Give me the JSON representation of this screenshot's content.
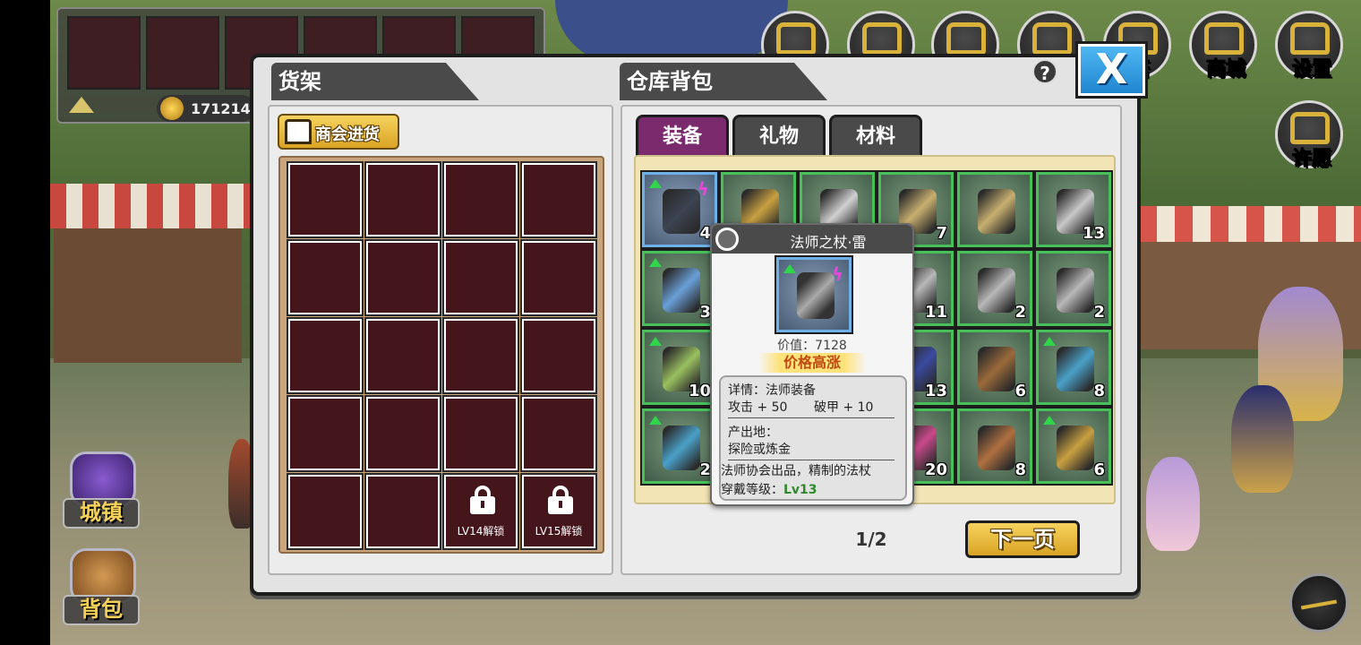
{
  "hud": {
    "coins": "171214"
  },
  "top_icons": [
    {
      "icon": "gift-icon",
      "label": ""
    },
    {
      "icon": "trophy-icon",
      "label": ""
    },
    {
      "icon": "badge-icon",
      "label": ""
    },
    {
      "icon": "glove-icon",
      "label": ""
    },
    {
      "icon": "helmet-icon",
      "label": "塔"
    },
    {
      "icon": "shop-icon",
      "label": "商城"
    },
    {
      "icon": "gear-icon",
      "label": "设置"
    },
    {
      "icon": "wish-icon",
      "label": "许愿"
    }
  ],
  "side_buttons": {
    "town": "城镇",
    "bag": "背包"
  },
  "shelf": {
    "title": "货架",
    "restock_label": "商会进货",
    "locked_slots": [
      "LV14解锁",
      "LV15解锁"
    ]
  },
  "warehouse": {
    "title": "仓库背包",
    "tabs": [
      "装备",
      "礼物",
      "材料"
    ],
    "active_tab": "装备",
    "items": [
      {
        "count": "4",
        "up": true,
        "bolt": true,
        "color": "#3c4452"
      },
      {
        "count": "",
        "up": false,
        "bolt": false,
        "color": "#c8a040"
      },
      {
        "count": "",
        "up": false,
        "bolt": false,
        "color": "#d0d0d0"
      },
      {
        "count": "7",
        "up": false,
        "bolt": false,
        "color": "#c8b070"
      },
      {
        "count": "",
        "up": false,
        "bolt": false,
        "color": "#c8b070"
      },
      {
        "count": "13",
        "up": false,
        "bolt": false,
        "color": "#c8c8c8"
      },
      {
        "count": "3",
        "up": true,
        "bolt": false,
        "color": "#6aa0d8"
      },
      {
        "count": "",
        "up": false,
        "bolt": false,
        "color": "#8a8a8a"
      },
      {
        "count": "",
        "up": false,
        "bolt": false,
        "color": "#8a8a8a"
      },
      {
        "count": "11",
        "up": false,
        "bolt": false,
        "color": "#b8b8b8"
      },
      {
        "count": "2",
        "up": false,
        "bolt": false,
        "color": "#b8b8b8"
      },
      {
        "count": "2",
        "up": false,
        "bolt": false,
        "color": "#b8b8b8"
      },
      {
        "count": "10",
        "up": true,
        "bolt": false,
        "color": "#9ac060"
      },
      {
        "count": "",
        "up": false,
        "bolt": false,
        "color": "#8a8a8a"
      },
      {
        "count": "",
        "up": false,
        "bolt": false,
        "color": "#8a8a8a"
      },
      {
        "count": "13",
        "up": false,
        "bolt": false,
        "color": "#3a4aa0"
      },
      {
        "count": "6",
        "up": false,
        "bolt": false,
        "color": "#9a6a3a"
      },
      {
        "count": "8",
        "up": true,
        "bolt": false,
        "color": "#4aa0c8"
      },
      {
        "count": "2",
        "up": true,
        "bolt": false,
        "color": "#4aa0c8"
      },
      {
        "count": "",
        "up": false,
        "bolt": false,
        "color": "#8a8a8a"
      },
      {
        "count": "",
        "up": false,
        "bolt": false,
        "color": "#8a8a8a"
      },
      {
        "count": "20",
        "up": false,
        "bolt": false,
        "color": "#c84a8a"
      },
      {
        "count": "8",
        "up": false,
        "bolt": false,
        "color": "#b07040"
      },
      {
        "count": "6",
        "up": true,
        "bolt": false,
        "color": "#c8a040"
      }
    ],
    "page": "1/2",
    "next_label": "下一页"
  },
  "tooltip": {
    "name": "法师之杖·雷",
    "value": "价值：7128",
    "price_tag": "价格高涨",
    "detail": "详情：法师装备",
    "attack": "攻击 + 50",
    "armor_break": "破甲 + 10",
    "origin_label": "产出地：",
    "origin": "探险或炼金",
    "desc": "法师协会出品，精制的法杖",
    "level_label": "穿戴等级：",
    "level": "Lv13"
  },
  "colors": {
    "active_tab": "#7b2a6e",
    "slot_border": "#48c05a",
    "selected_border": "#6fb0e6",
    "button_gold": "#d9a424",
    "close_blue": "#1f86d0"
  }
}
